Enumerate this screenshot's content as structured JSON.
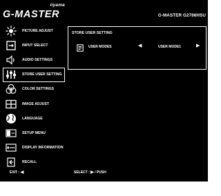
{
  "header": {
    "brand_sub": "iiyama",
    "brand": "G-MASTER",
    "model": "G-MASTER G2766HSU"
  },
  "menu": {
    "items": [
      {
        "label": "PICTURE ADJUST",
        "icon": "picture-adjust-icon"
      },
      {
        "label": "INPUT SELECT",
        "icon": "input-select-icon"
      },
      {
        "label": "AUDIO SETTINGS",
        "icon": "speaker-icon"
      },
      {
        "label": "STORE USER SETTING",
        "icon": "sliders-icon",
        "selected": true
      },
      {
        "label": "COLOR SETTINGS",
        "icon": "color-circles-icon"
      },
      {
        "label": "IMAGE ADJUST",
        "icon": "image-adjust-icon"
      },
      {
        "label": "LANGUAGE",
        "icon": "globe-icon"
      },
      {
        "label": "SETUP MENU",
        "icon": "setup-menu-icon"
      },
      {
        "label": "DISPLAY INFORMATION",
        "icon": "display-information-icon"
      },
      {
        "label": "RECALL",
        "icon": "recall-icon"
      }
    ]
  },
  "panel": {
    "title": "STORE USER SETTING",
    "row": {
      "label": "USER MODES",
      "value": "USER MODE1",
      "left_arrow": "◀",
      "right_arrow": "▶"
    }
  },
  "footer": {
    "exit_label": "EXIT :",
    "exit_arrow": "◀",
    "select_label": "SELECT :",
    "select_arrow": "▶",
    "select_suffix": "/ PUSH"
  }
}
